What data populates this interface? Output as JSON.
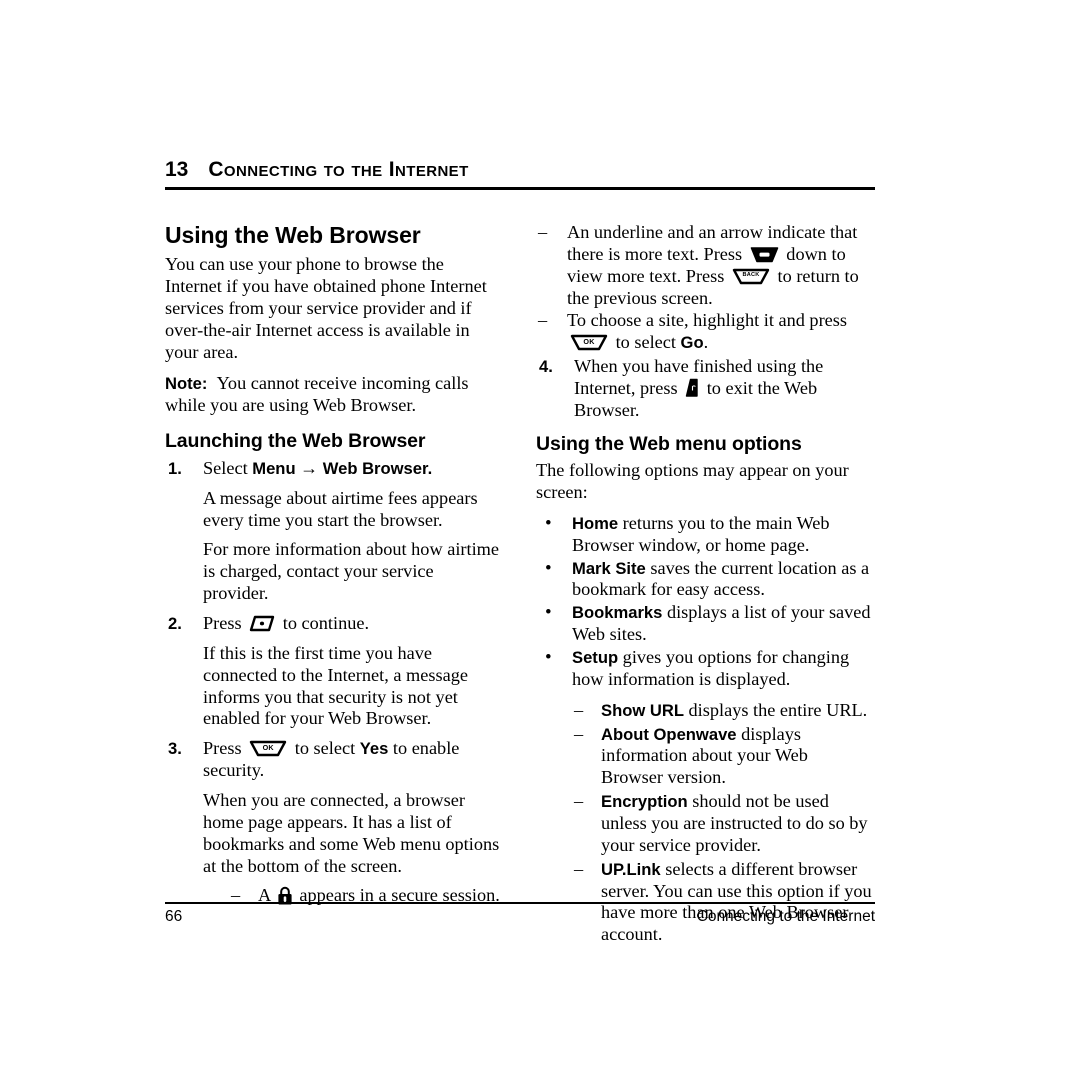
{
  "chapter": {
    "number": "13",
    "title": "Connecting to the Internet"
  },
  "left_column": {
    "section_title": "Using the Web Browser",
    "intro": "You can use your phone to browse the Internet if you have obtained phone Internet services from your service provider and if over-the-air Internet access is available in your area.",
    "note_label": "Note:",
    "note_text": "You cannot receive incoming calls while you are using Web Browser.",
    "subsection_title": "Launching the Web Browser",
    "steps": [
      {
        "marker": "1.",
        "lead_pre": "Select ",
        "lead_bold_1": "Menu",
        "lead_arrow": "→",
        "lead_bold_2": "Web Browser",
        "lead_post": ".",
        "paragraphs": [
          "A message about airtime fees appears every time you start the browser.",
          "For more information about how airtime is charged, contact your service provider."
        ]
      },
      {
        "marker": "2.",
        "lead_pre": "Press ",
        "icon": "softkey-icon",
        "lead_post": " to continue.",
        "paragraphs": [
          "If this is the first time you have connected to the Internet, a message informs you that security is not yet enabled for your Web Browser."
        ]
      },
      {
        "marker": "3.",
        "lead_pre": "Press ",
        "icon": "ok-key-icon",
        "lead_mid": " to select ",
        "lead_bold_1": "Yes",
        "lead_post": " to enable security.",
        "paragraphs": [
          "When you are connected, a browser home page appears. It has a list of bookmarks and some Web menu options at the bottom of the screen."
        ],
        "sub_dashes": [
          {
            "pre": "A ",
            "icon": "padlock-icon",
            "post": " appears in a secure session."
          }
        ]
      }
    ]
  },
  "right_column": {
    "top_dashes": [
      {
        "seg1": "An underline and an arrow indicate that there is more text. Press ",
        "icon1": "nav-key-icon",
        "seg2": " down to view more text. Press ",
        "icon2": "back-key-icon",
        "seg3": " to return to the previous screen."
      },
      {
        "seg1": "To choose a site, highlight it and press ",
        "icon1": "ok-key-icon",
        "seg2": " to select ",
        "bold1": "Go",
        "seg3": "."
      }
    ],
    "step4": {
      "marker": "4.",
      "seg1": "When you have finished using the Internet, press ",
      "icon1": "end-key-icon",
      "seg2": " to exit the Web Browser."
    },
    "subsection_title": "Using the Web menu options",
    "intro": "The following options may appear on your screen:",
    "bullets": [
      {
        "bold": "Home",
        "text": " returns you to the main Web Browser window, or home page."
      },
      {
        "bold": "Mark Site",
        "text": " saves the current location as a bookmark for easy access."
      },
      {
        "bold": "Bookmarks",
        "text": " displays a list of your saved Web sites."
      },
      {
        "bold": "Setup",
        "text": " gives you options for changing how information is displayed."
      }
    ],
    "setup_dashes": [
      {
        "bold": "Show URL",
        "text": " displays the entire URL."
      },
      {
        "bold": "About Openwave",
        "text": " displays information about your Web Browser version."
      },
      {
        "bold": "Encryption",
        "text": " should not be used unless you are instructed to do so by your service provider."
      },
      {
        "bold": "UP.Link",
        "text": " selects a different browser server. You can use this option if you have more than one Web Browser account."
      }
    ]
  },
  "footer": {
    "page_number": "66",
    "chapter_label": "Connecting to the Internet"
  },
  "colors": {
    "text": "#000000",
    "background": "#ffffff",
    "rule": "#000000"
  }
}
